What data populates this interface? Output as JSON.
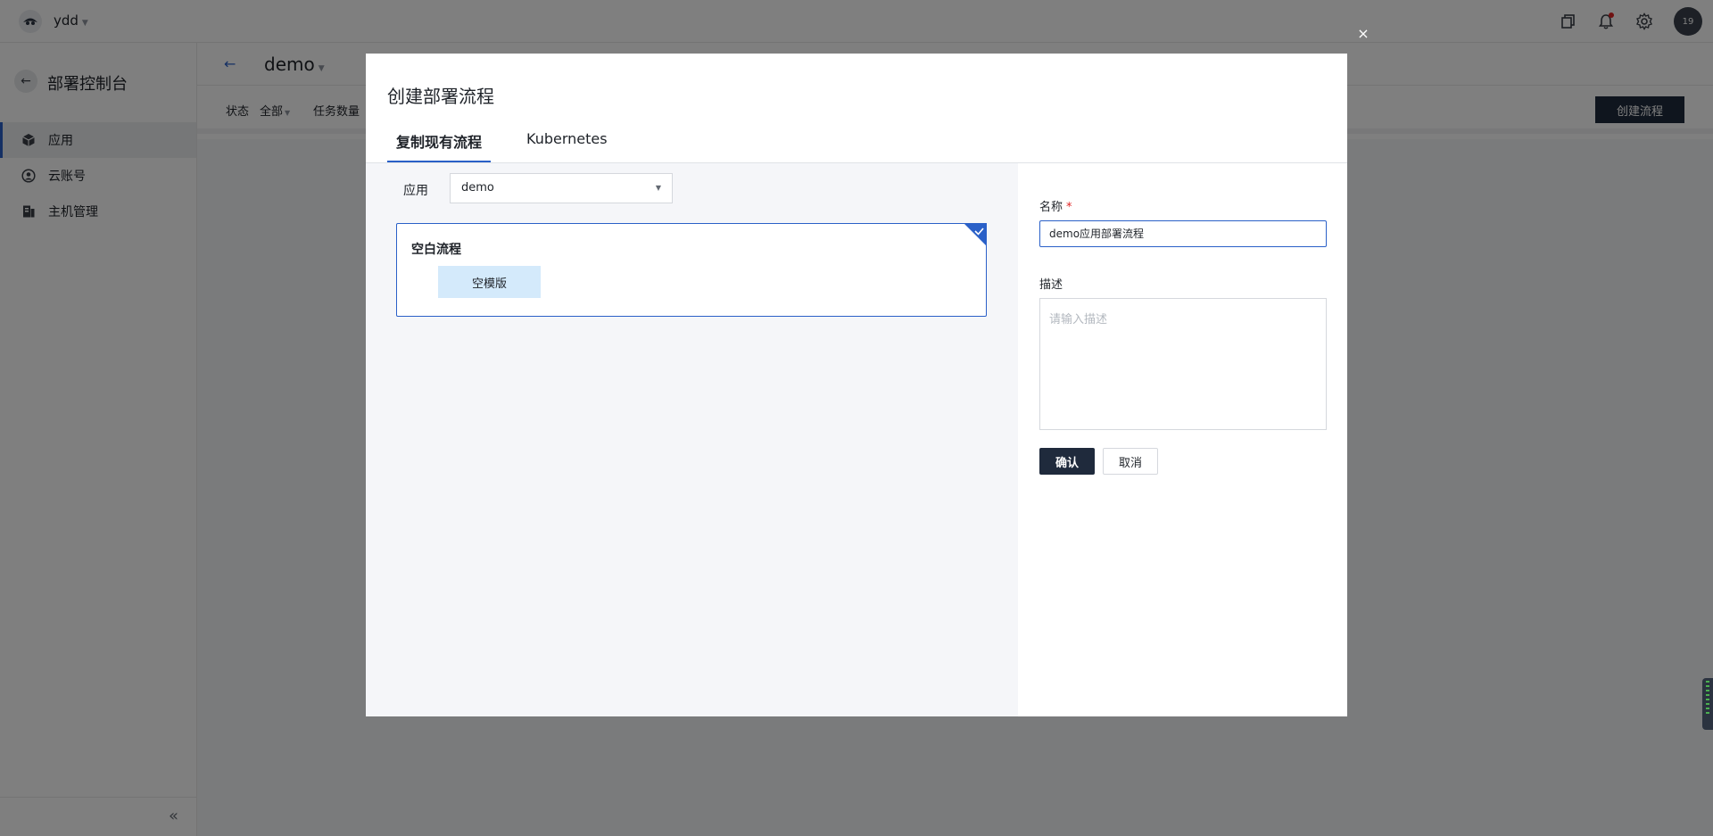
{
  "topbar": {
    "org_name": "ydd",
    "avatar_text": "19"
  },
  "sidebar": {
    "console_title": "部署控制台",
    "items": [
      {
        "label": "应用",
        "icon": "cube-icon",
        "active": true
      },
      {
        "label": "云账号",
        "icon": "user-circle-icon",
        "active": false
      },
      {
        "label": "主机管理",
        "icon": "server-icon",
        "active": false
      }
    ]
  },
  "main": {
    "app_name": "demo",
    "filters": {
      "status_label": "状态",
      "status_value": "全部",
      "task_count_label": "任务数量"
    },
    "create_flow_button": "创建流程"
  },
  "modal": {
    "title": "创建部署流程",
    "tabs": [
      {
        "label": "复制现有流程",
        "active": true
      },
      {
        "label": "Kubernetes",
        "active": false
      }
    ],
    "app_label": "应用",
    "app_select_value": "demo",
    "template_card": {
      "title": "空白流程",
      "chip": "空模版",
      "selected": true
    },
    "form": {
      "name_label": "名称",
      "required_mark": "*",
      "name_value": "demo应用部署流程",
      "desc_label": "描述",
      "desc_placeholder": "请输入描述",
      "confirm": "确认",
      "cancel": "取消"
    },
    "close_symbol": "×"
  },
  "colors": {
    "accent": "#2a60c8",
    "primary_button": "#1f2a3c",
    "chip_bg": "#d4eafb",
    "required": "#e02424"
  }
}
